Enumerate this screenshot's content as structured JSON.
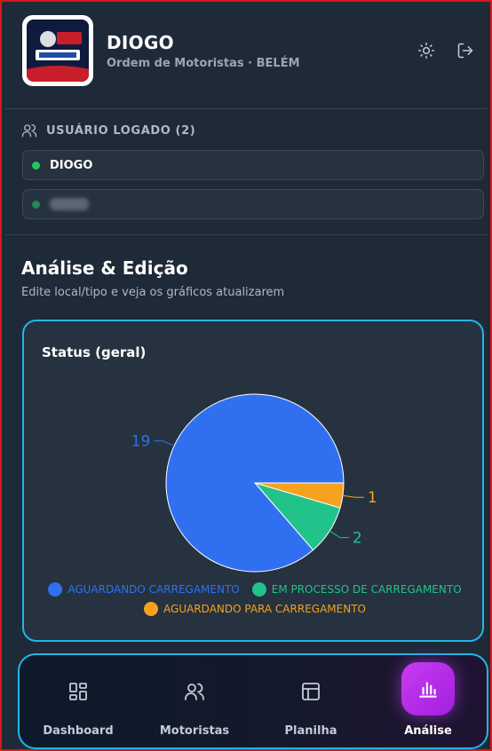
{
  "header": {
    "title": "DIOGO",
    "subtitle": "Ordem de Motoristas · BELÉM",
    "logo_icon": "company-logo",
    "theme_icon": "sun-icon",
    "logout_icon": "logout-icon"
  },
  "users": {
    "heading": "USUÁRIO LOGADO (2)",
    "list": [
      {
        "name": "DIOGO",
        "status_color": "#22c55e"
      },
      {
        "name": "",
        "status_color": "#22c55e",
        "blurred": true
      }
    ]
  },
  "section": {
    "title": "Análise & Edição",
    "subtitle": "Edite local/tipo e veja os gráficos atualizarem"
  },
  "chart_card": {
    "title": "Status (geral)"
  },
  "chart_data": {
    "type": "pie",
    "title": "Status (geral)",
    "slices": [
      {
        "label": "AGUARDANDO CARREGAMENTO",
        "value": 19,
        "color": "#3070f0"
      },
      {
        "label": "EM PROCESSO DE CARREGAMENTO",
        "value": 2,
        "color": "#22c38a"
      },
      {
        "label": "AGUARDANDO PARA CARREGAMENTO",
        "value": 1,
        "color": "#f6a21e"
      }
    ],
    "legend_position": "bottom"
  },
  "nav": {
    "items": [
      {
        "label": "Dashboard",
        "icon": "dashboard-grid-icon",
        "active": false
      },
      {
        "label": "Motoristas",
        "icon": "users-icon",
        "active": false
      },
      {
        "label": "Planilha",
        "icon": "table-icon",
        "active": false
      },
      {
        "label": "Análise",
        "icon": "bar-chart-icon",
        "active": true
      }
    ]
  }
}
